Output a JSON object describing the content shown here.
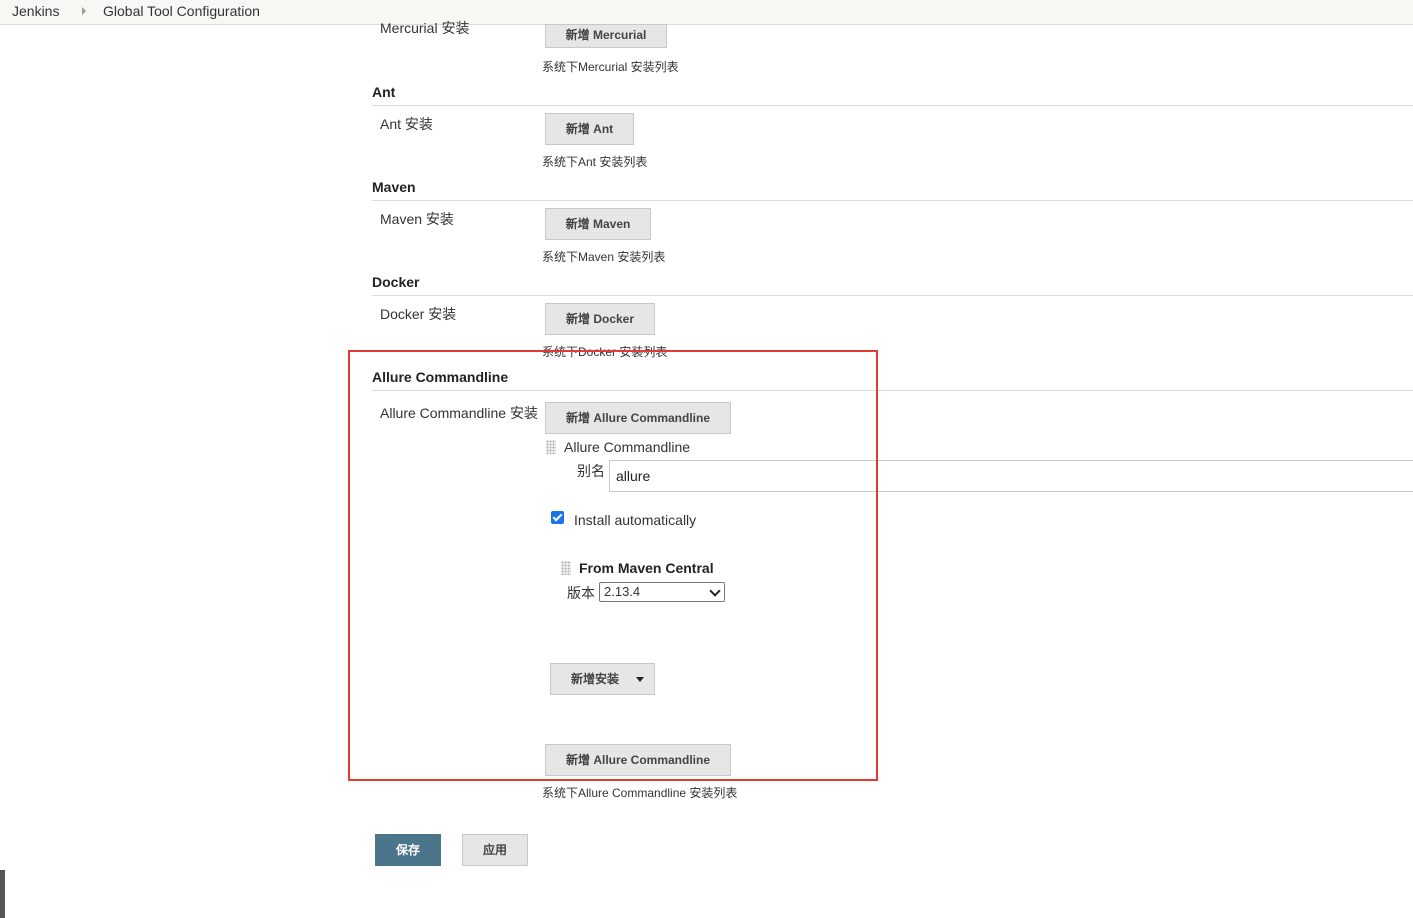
{
  "breadcrumb": {
    "home": "Jenkins",
    "current": "Global Tool Configuration"
  },
  "mercurial": {
    "label": "Mercurial 安装",
    "add_button": "新增 Mercurial",
    "desc": "系统下Mercurial 安装列表"
  },
  "ant": {
    "title": "Ant",
    "label": "Ant 安装",
    "add_button": "新增 Ant",
    "desc": "系统下Ant 安装列表"
  },
  "maven": {
    "title": "Maven",
    "label": "Maven 安装",
    "add_button": "新增 Maven",
    "desc": "系统下Maven 安装列表"
  },
  "docker": {
    "title": "Docker",
    "label": "Docker 安装",
    "add_button": "新增 Docker",
    "desc": "系统下Docker 安装列表"
  },
  "allure": {
    "title": "Allure Commandline",
    "label": "Allure Commandline 安装",
    "add_button_top": "新增 Allure Commandline",
    "installation_header": "Allure Commandline",
    "alias_label": "别名",
    "alias_value": "allure",
    "install_auto_label": "Install automatically",
    "install_auto_checked": true,
    "installer_title": "From Maven Central",
    "version_label": "版本",
    "version_value": "2.13.4",
    "add_installer_button": "新增安装",
    "add_button_bottom": "新增 Allure Commandline",
    "desc": "系统下Allure Commandline 安装列表"
  },
  "actions": {
    "save": "保存",
    "apply": "应用"
  },
  "colors": {
    "save_bg": "#4b758b",
    "highlight_border": "#e53935",
    "checkbox": "#1a73e8"
  }
}
